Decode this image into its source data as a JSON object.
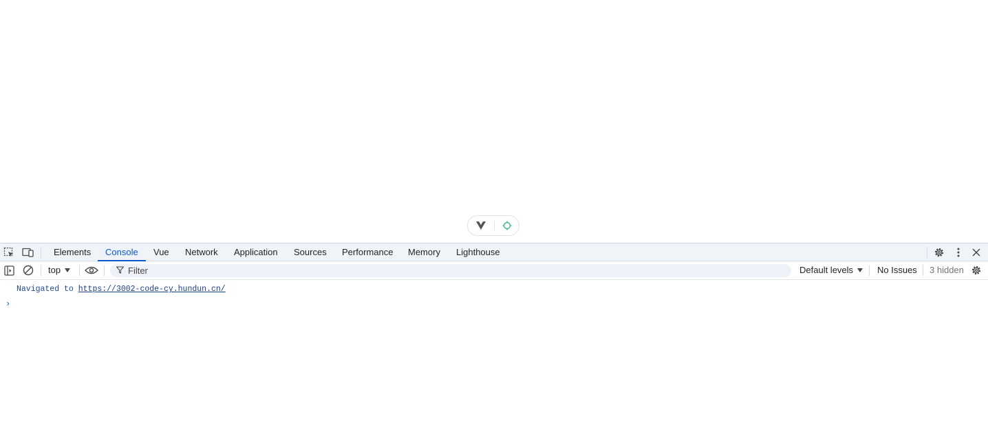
{
  "vue_pill": {
    "left_icon": "vue-logo-icon",
    "right_icon": "target-icon"
  },
  "tabbar": {
    "icons": {
      "inspect": "inspect-element-icon",
      "device": "device-toolbar-icon"
    },
    "tabs": [
      "Elements",
      "Console",
      "Vue",
      "Network",
      "Application",
      "Sources",
      "Performance",
      "Memory",
      "Lighthouse"
    ],
    "active_tab": "Console",
    "right_icons": [
      "settings-icon",
      "more-vertical-icon",
      "close-icon"
    ]
  },
  "toolbar": {
    "context": "top",
    "filter_placeholder": "Filter",
    "levels": "Default levels",
    "issues": "No Issues",
    "hidden": "3 hidden"
  },
  "console": {
    "message_prefix": "Navigated to",
    "message_url": "https://3002-code-cy.hundun.cn/",
    "prompt": "›"
  },
  "colors": {
    "accent": "#0b57d0",
    "tabbar_bg": "#f0f4f9",
    "filter_bg": "#eef2f8"
  }
}
